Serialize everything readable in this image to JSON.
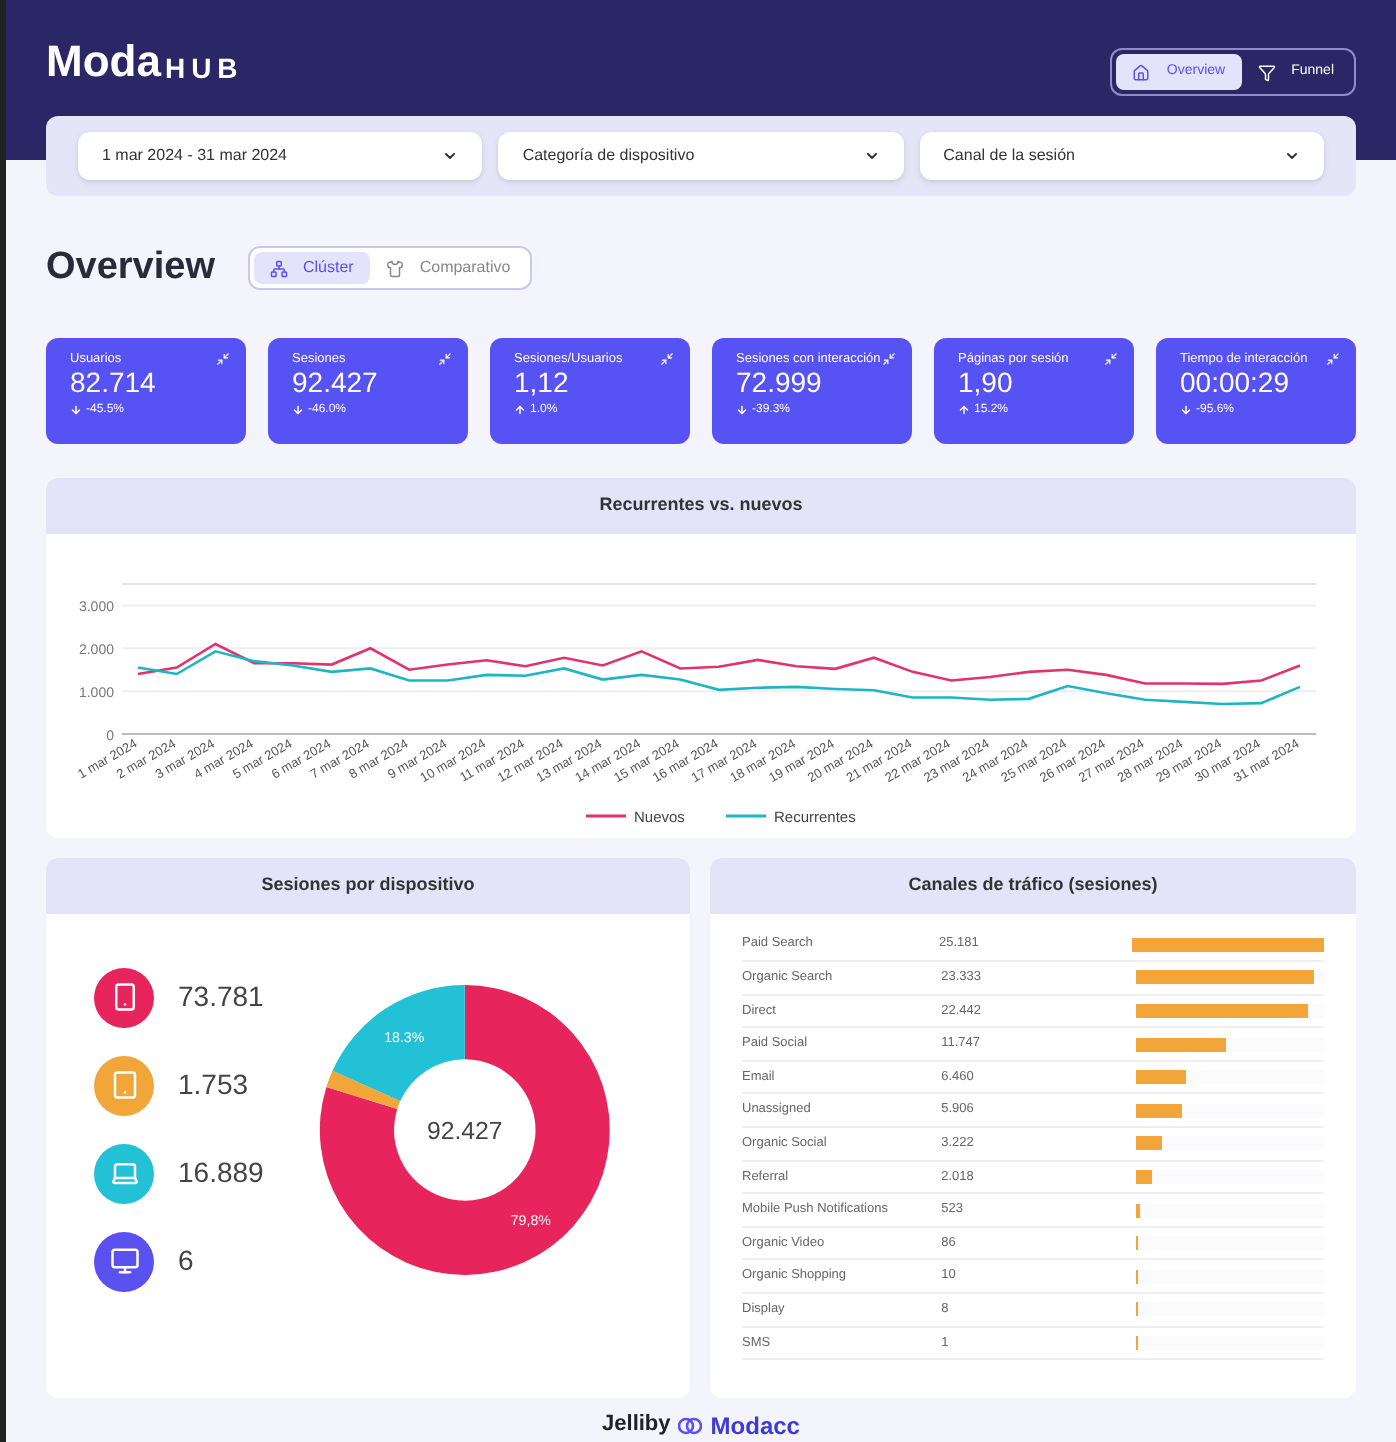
{
  "header": {
    "logo_main": "Moda",
    "logo_sub": "HUB",
    "nav": [
      {
        "label": "Overview",
        "kind": "home",
        "selected": true
      },
      {
        "label": "Funnel",
        "kind": "filter",
        "selected": false
      }
    ]
  },
  "filters": [
    {
      "value": "1 mar 2024 - 31 mar 2024"
    },
    {
      "value": "Categoría de dispositivo"
    },
    {
      "value": "Canal de la sesión"
    }
  ],
  "page_title": "Overview",
  "views": [
    {
      "label": "Clúster",
      "kind": "cluster",
      "selected": true
    },
    {
      "label": "Comparativo",
      "kind": "shirt",
      "selected": false
    }
  ],
  "kpis": [
    {
      "label": "Usuarios",
      "value": "82.714",
      "delta": "-45.5%",
      "kind": "down"
    },
    {
      "label": "Sesiones",
      "value": "92.427",
      "delta": "-46.0%",
      "kind": "down"
    },
    {
      "label": "Sesiones/Usuarios",
      "value": "1,12",
      "delta": "1.0%",
      "kind": "up"
    },
    {
      "label": "Sesiones con interacción",
      "value": "72.999",
      "delta": "-39.3%",
      "kind": "down"
    },
    {
      "label": "Páginas por sesión",
      "value": "1,90",
      "delta": "15.2%",
      "kind": "up"
    },
    {
      "label": "Tiempo de interacción",
      "value": "00:00:29",
      "delta": "-95.6%",
      "kind": "down"
    }
  ],
  "line_card": {
    "title": "Recurrentes vs. nuevos",
    "chart_data": {
      "type": "line",
      "categories": [
        "1 mar 2024",
        "2 mar 2024",
        "3 mar 2024",
        "4 mar 2024",
        "5 mar 2024",
        "6 mar 2024",
        "7 mar 2024",
        "8 mar 2024",
        "9 mar 2024",
        "10 mar 2024",
        "11 mar 2024",
        "12 mar 2024",
        "13 mar 2024",
        "14 mar 2024",
        "15 mar 2024",
        "16 mar 2024",
        "17 mar 2024",
        "18 mar 2024",
        "19 mar 2024",
        "20 mar 2024",
        "21 mar 2024",
        "22 mar 2024",
        "23 mar 2024",
        "24 mar 2024",
        "25 mar 2024",
        "26 mar 2024",
        "27 mar 2024",
        "28 mar 2024",
        "29 mar 2024",
        "30 mar 2024",
        "31 mar 2024"
      ],
      "series": [
        {
          "name": "Nuevos",
          "color": "#e0336f",
          "values": [
            1.4,
            1.55,
            2.1,
            1.65,
            1.65,
            1.62,
            2.0,
            1.5,
            1.62,
            1.72,
            1.58,
            1.78,
            1.6,
            1.93,
            1.53,
            1.57,
            1.73,
            1.58,
            1.52,
            1.78,
            1.45,
            1.25,
            1.33,
            1.45,
            1.5,
            1.38,
            1.18,
            1.18,
            1.17,
            1.25,
            1.6
          ]
        },
        {
          "name": "Recurrentes",
          "color": "#1fb5c4",
          "values": [
            1.55,
            1.4,
            1.93,
            1.7,
            1.6,
            1.45,
            1.53,
            1.25,
            1.25,
            1.38,
            1.36,
            1.53,
            1.27,
            1.38,
            1.27,
            1.03,
            1.08,
            1.1,
            1.05,
            1.02,
            0.85,
            0.85,
            0.8,
            0.82,
            1.12,
            0.95,
            0.8,
            0.75,
            0.7,
            0.72,
            1.1
          ]
        }
      ],
      "ylim": [
        0,
        3.5
      ],
      "grid": true,
      "legend": true,
      "yticks": [
        {
          "value": 0,
          "label": "0"
        },
        {
          "value": 1,
          "label": "1.000"
        },
        {
          "value": 2,
          "label": "2.000"
        },
        {
          "value": 3,
          "label": "3.000"
        }
      ]
    }
  },
  "device_card": {
    "title": "Sesiones por dispositivo",
    "devices": [
      {
        "kind": "phone",
        "value": "73.781",
        "color": "#e8245c"
      },
      {
        "kind": "tablet",
        "value": "1.753",
        "color": "#f2a63a"
      },
      {
        "kind": "laptop",
        "value": "16.889",
        "color": "#22c1d6"
      },
      {
        "kind": "desktop",
        "value": "6",
        "color": "#5b50f0"
      }
    ],
    "total": "92.427",
    "chart_data": {
      "type": "donut",
      "values": [
        79.8,
        1.9,
        18.3,
        0
      ],
      "value_labels": [
        "79,8%",
        null,
        "18.3%",
        null
      ]
    }
  },
  "channel_card": {
    "title": "Canales de tráfico (sesiones)",
    "rows": [
      {
        "name": "Paid Search",
        "value": "25.181",
        "level": 1
      },
      {
        "name": "Organic Search",
        "value": "23.333",
        "level": 0.927
      },
      {
        "name": "Direct",
        "value": "22.442",
        "level": 0.891
      },
      {
        "name": "Paid Social",
        "value": "11.747",
        "level": 0.466
      },
      {
        "name": "Email",
        "value": "6.460",
        "level": 0.257
      },
      {
        "name": "Unassigned",
        "value": "5.906",
        "level": 0.235
      },
      {
        "name": "Organic Social",
        "value": "3.222",
        "level": 0.128
      },
      {
        "name": "Referral",
        "value": "2.018",
        "level": 0.08
      },
      {
        "name": "Mobile Push Notifications",
        "value": "523",
        "level": 0.021
      },
      {
        "name": "Organic Video",
        "value": "86",
        "level": 0.0034
      },
      {
        "name": "Organic Shopping",
        "value": "10",
        "level": 0.0004
      },
      {
        "name": "Display",
        "value": "8",
        "level": 0.0003
      },
      {
        "name": "SMS",
        "value": "1",
        "level": 4e-05
      }
    ]
  },
  "footer": {
    "brand_left": "Jelliby",
    "brand_right": "Modacc"
  }
}
